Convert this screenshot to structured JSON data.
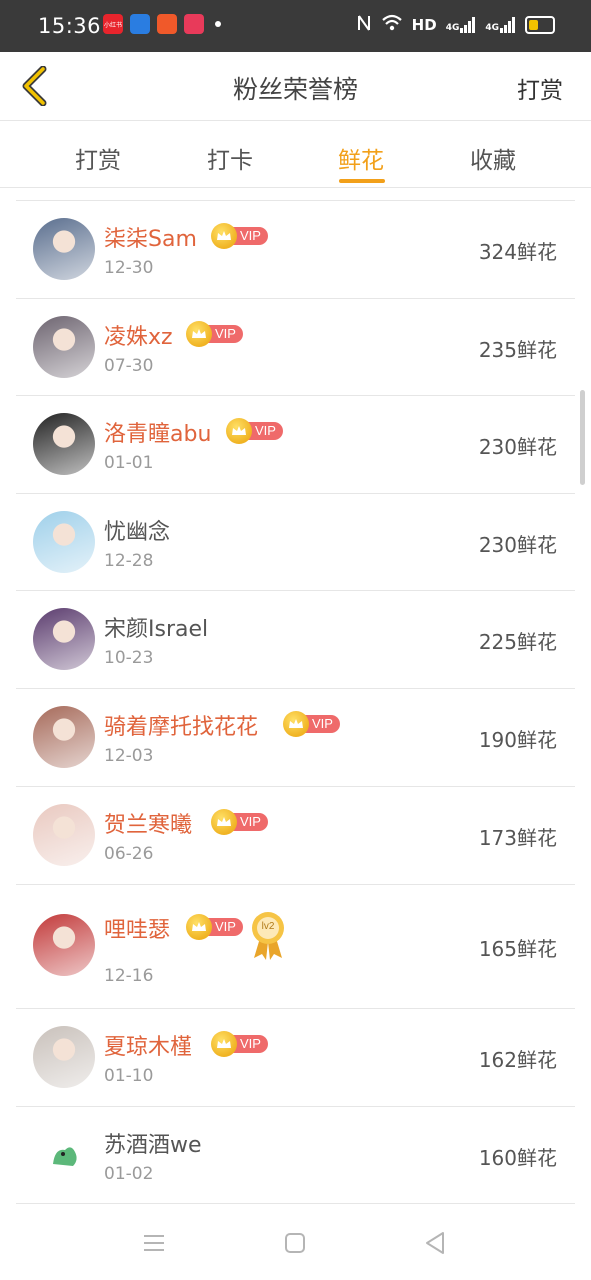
{
  "status_bar": {
    "time": "15:36",
    "apps": [
      {
        "name": "app-icon-1",
        "color": "#e8242c",
        "label": "小红书"
      },
      {
        "name": "app-icon-2",
        "color": "#2a7de1",
        "label": ""
      },
      {
        "name": "app-icon-3",
        "color": "#f0592a",
        "label": ""
      },
      {
        "name": "app-icon-4",
        "color": "#e83a5a",
        "label": ""
      }
    ],
    "network": "HD",
    "signal1": "4G",
    "signal2": "4G"
  },
  "header": {
    "title": "粉丝荣誉榜",
    "action_label": "打赏"
  },
  "tabs": [
    {
      "label": "打赏",
      "active": false
    },
    {
      "label": "打卡",
      "active": false
    },
    {
      "label": "鲜花",
      "active": true
    },
    {
      "label": "收藏",
      "active": false
    }
  ],
  "vip_label": "VIP",
  "medal_label": "lv2",
  "fans": [
    {
      "name": "柒柒Sam",
      "date": "12-30",
      "count": "324鲜花",
      "vip": true,
      "avatar_color": "#5a6e8e"
    },
    {
      "name": "凌姝xz",
      "date": "07-30",
      "count": "235鲜花",
      "vip": true,
      "avatar_color": "#6d6470"
    },
    {
      "name": "洛青瞳abu",
      "date": "01-01",
      "count": "230鲜花",
      "vip": true,
      "avatar_color": "#222222"
    },
    {
      "name": "忧幽念",
      "date": "12-28",
      "count": "230鲜花",
      "vip": false,
      "avatar_color": "#9fd0ea"
    },
    {
      "name": "宋颜Israel",
      "date": "10-23",
      "count": "225鲜花",
      "vip": false,
      "avatar_color": "#5b3c6e"
    },
    {
      "name": "骑着摩托找花花",
      "date": "12-03",
      "count": "190鲜花",
      "vip": true,
      "avatar_color": "#a66a5a"
    },
    {
      "name": "贺兰寒曦",
      "date": "06-26",
      "count": "173鲜花",
      "vip": true,
      "avatar_color": "#e9c9c0"
    },
    {
      "name": "哩哇瑟",
      "date": "12-16",
      "count": "165鲜花",
      "vip": true,
      "medal": true,
      "avatar_color": "#c23a3a"
    },
    {
      "name": "夏琼木槿",
      "date": "01-10",
      "count": "162鲜花",
      "vip": true,
      "avatar_color": "#c9c1bb"
    },
    {
      "name": "苏酒酒we",
      "date": "01-02",
      "count": "160鲜花",
      "vip": false,
      "avatar_color": "#ffffff"
    }
  ],
  "colors": {
    "accent": "#f2a01a",
    "vip_name": "#e0643c",
    "vip_tag": "#ef6a6a"
  }
}
